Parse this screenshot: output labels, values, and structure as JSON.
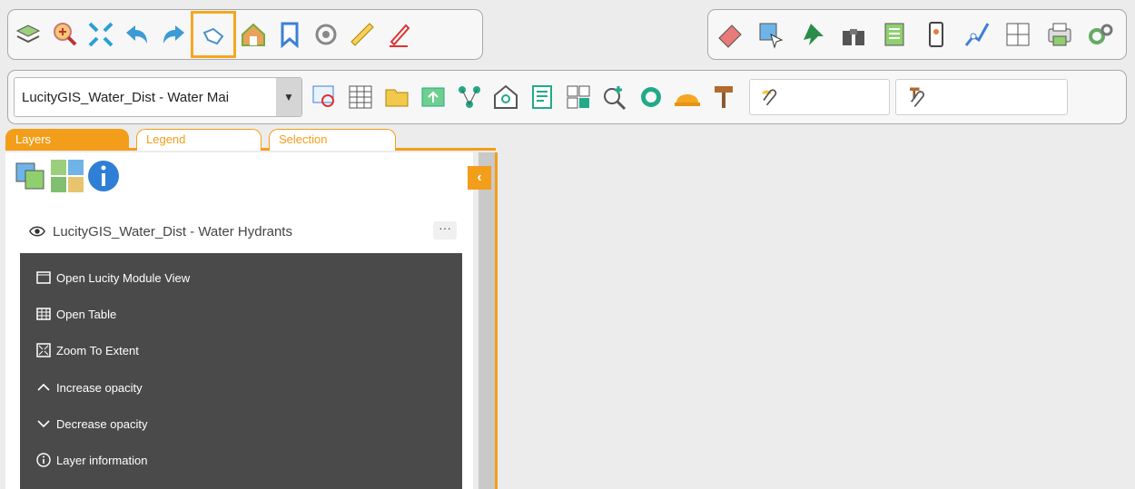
{
  "toolbar_left": {
    "icons": [
      "layers-icon",
      "zoom-in-icon",
      "full-extent-icon",
      "back-icon",
      "forward-icon",
      "pan-hand-icon",
      "home-icon",
      "bookmark-icon",
      "locate-icon",
      "measure-icon",
      "draw-icon"
    ],
    "selected": "pan-hand-icon"
  },
  "toolbar_right": {
    "icons": [
      "eraser-icon",
      "select-features-icon",
      "pin-icon",
      "binoculars-icon",
      "map-notes-icon",
      "mobile-icon",
      "route-icon",
      "copy-icon",
      "print-icon",
      "settings-icon"
    ]
  },
  "toolbar_main": {
    "layer_select": "LucityGIS_Water_Dist - Water Mai",
    "icons": [
      "identify-icon",
      "table-icon",
      "open-folder-icon",
      "upload-icon",
      "network-trace-icon",
      "search-home-icon",
      "document-icon",
      "compare-icon",
      "zoom-add-icon",
      "headset-icon",
      "hard-hat-icon",
      "hammer-icon"
    ],
    "attachment_field_1": "",
    "attachment_field_2": ""
  },
  "tabs": [
    "Layers",
    "Legend",
    "Selection"
  ],
  "panel": {
    "collapse_glyph": "‹",
    "layer_name": "LucityGIS_Water_Dist - Water Hydrants",
    "more_label": "···",
    "menu_items": [
      "Open Lucity Module View",
      "Open Table",
      "Zoom To Extent",
      "Increase opacity",
      "Decrease opacity",
      "Layer information"
    ]
  },
  "colors": {
    "accent": "#f39e1a",
    "menu_bg": "#4a4a4a"
  }
}
